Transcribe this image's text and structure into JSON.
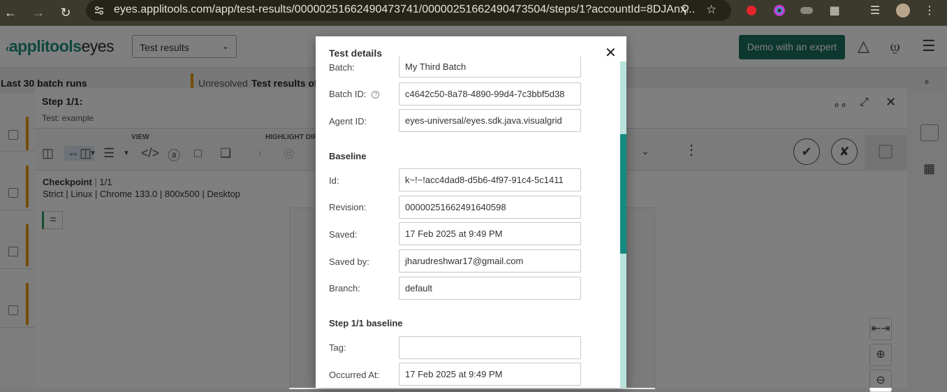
{
  "browser": {
    "url": "eyes.applitools.com/app/test-results/00000251662490473741/00000251662490473504/steps/1?accountId=8DJAnx...",
    "nav_back": "←",
    "nav_forward": "→",
    "nav_reload": "↻"
  },
  "app": {
    "logo_brand": "applitools",
    "logo_product": "eyes",
    "view_select": "Test results",
    "demo_button": "Demo with an expert",
    "batch_runs_label": "Last 30 batch runs",
    "unresolved_label": "Unresolved",
    "test_results_label": "Test results of b"
  },
  "step": {
    "title": "Step 1/1:",
    "test_name": "Test: example",
    "view_group": "VIEW",
    "highlight_group": "HIGHLIGHT DIFFS",
    "checkpoint_label": "Checkpoint",
    "checkpoint_count": "1/1",
    "meta": "Strict  |  Linux  |  Chrome 133.0  |  800x500  |  Desktop"
  },
  "modal": {
    "title": "Test details",
    "fields_top": [
      {
        "label": "Batch:",
        "value": "My Third Batch"
      },
      {
        "label": "Batch ID:",
        "value": "c4642c50-8a78-4890-99d4-7c3bbf5d38",
        "help": "?"
      },
      {
        "label": "Agent ID:",
        "value": "eyes-universal/eyes.sdk.java.visualgrid"
      }
    ],
    "baseline_title": "Baseline",
    "baseline_fields": [
      {
        "label": "Id:",
        "value": "k~!~!acc4dad8-d5b6-4f97-91c4-5c1411"
      },
      {
        "label": "Revision:",
        "value": "00000251662491640598"
      },
      {
        "label": "Saved:",
        "value": "17 Feb 2025 at 9:49 PM"
      },
      {
        "label": "Saved by:",
        "value": "jharudreshwar17@gmail.com"
      },
      {
        "label": "Branch:",
        "value": "default"
      }
    ],
    "step_baseline_title": "Step 1/1 baseline",
    "step_fields": [
      {
        "label": "Tag:",
        "value": ""
      },
      {
        "label": "Occurred At:",
        "value": "17 Feb 2025 at 9:49 PM"
      }
    ]
  },
  "colors": {
    "brand_teal": "#1b6e5f",
    "scroll_thumb": "#168a80",
    "accent_orange": "#e69a13"
  }
}
